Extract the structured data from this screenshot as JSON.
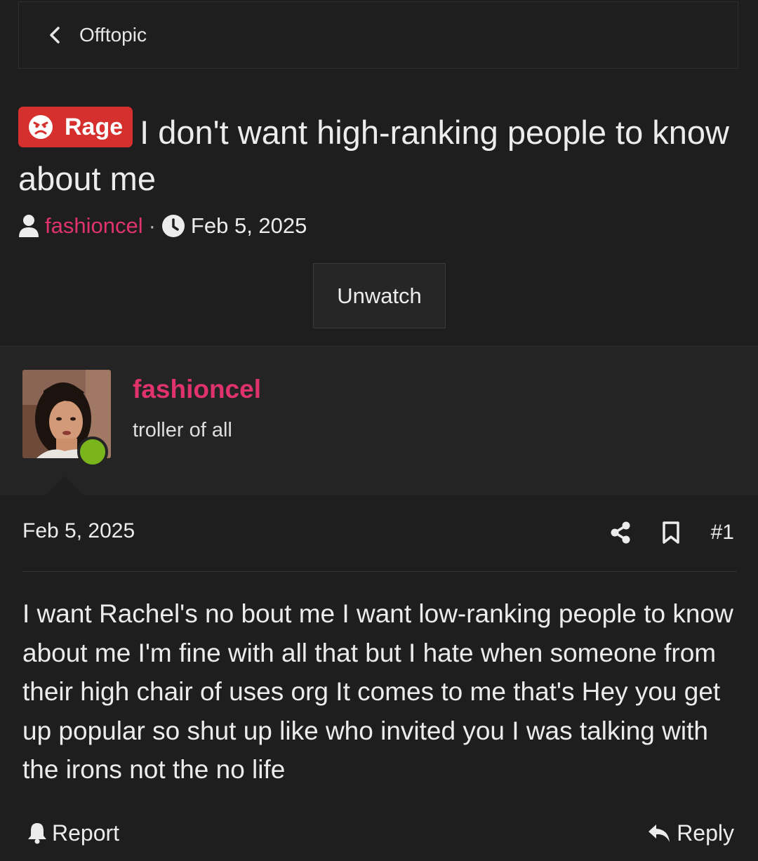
{
  "breadcrumb": {
    "label": "Offtopic",
    "icon": "chevron-left-icon"
  },
  "thread": {
    "prefix": {
      "label": "Rage",
      "icon": "angry-face-icon",
      "color": "#d6302e"
    },
    "title": "I don't want high-ranking people to know about me",
    "author": "fashioncel",
    "separator": "·",
    "date": "Feb 5, 2025",
    "watch_button": "Unwatch"
  },
  "post": {
    "username": "fashioncel",
    "user_title": "troller of all",
    "online": true,
    "date": "Feb 5, 2025",
    "number": "#1",
    "body": "I want Rachel's no bout me I want low-ranking people to know about me I'm fine with all that but I hate when someone from their high chair of uses org It comes to me that's Hey you get up popular so shut up like who invited you I was talking with the irons not the no life",
    "actions": {
      "report": "Report",
      "reply": "Reply"
    }
  },
  "colors": {
    "background": "#1e1e1e",
    "panel": "#242424",
    "accent_username": "#e0336c",
    "online": "#7ab51d"
  }
}
